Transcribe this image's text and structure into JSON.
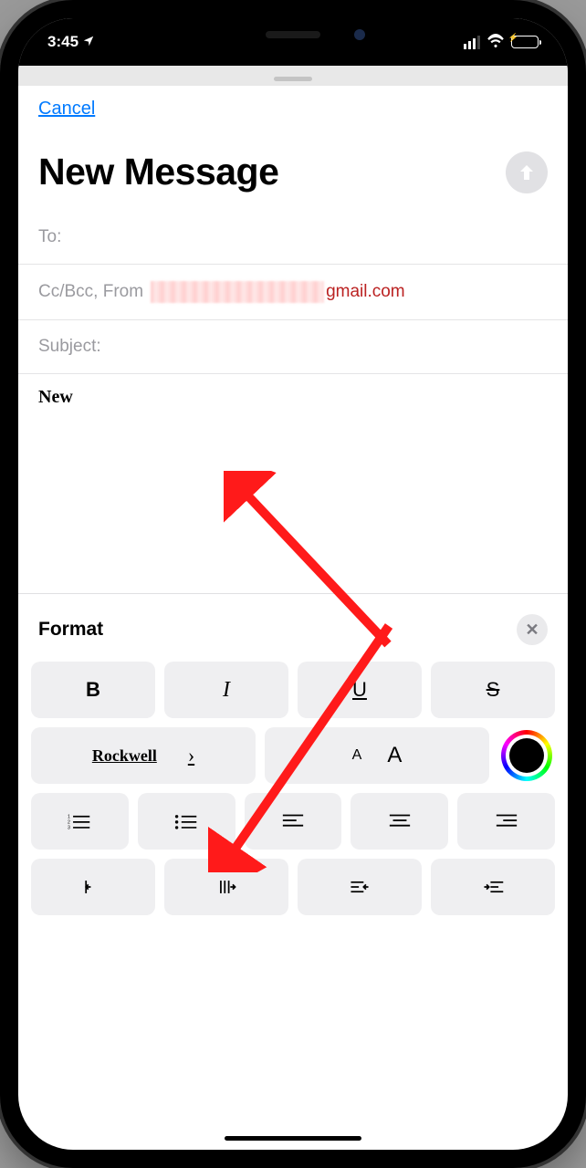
{
  "statusbar": {
    "time": "3:45"
  },
  "header": {
    "cancel": "Cancel",
    "title": "New Message"
  },
  "fields": {
    "to_label": "To:",
    "ccbcc_label": "Cc/Bcc, From",
    "email_domain": "gmail.com",
    "subject_label": "Subject:"
  },
  "body": {
    "text": "New"
  },
  "format": {
    "title": "Format",
    "bold": "B",
    "italic": "I",
    "underline": "U",
    "strike": "S",
    "font_name": "Rockwell",
    "size_small": "A",
    "size_large": "A"
  }
}
